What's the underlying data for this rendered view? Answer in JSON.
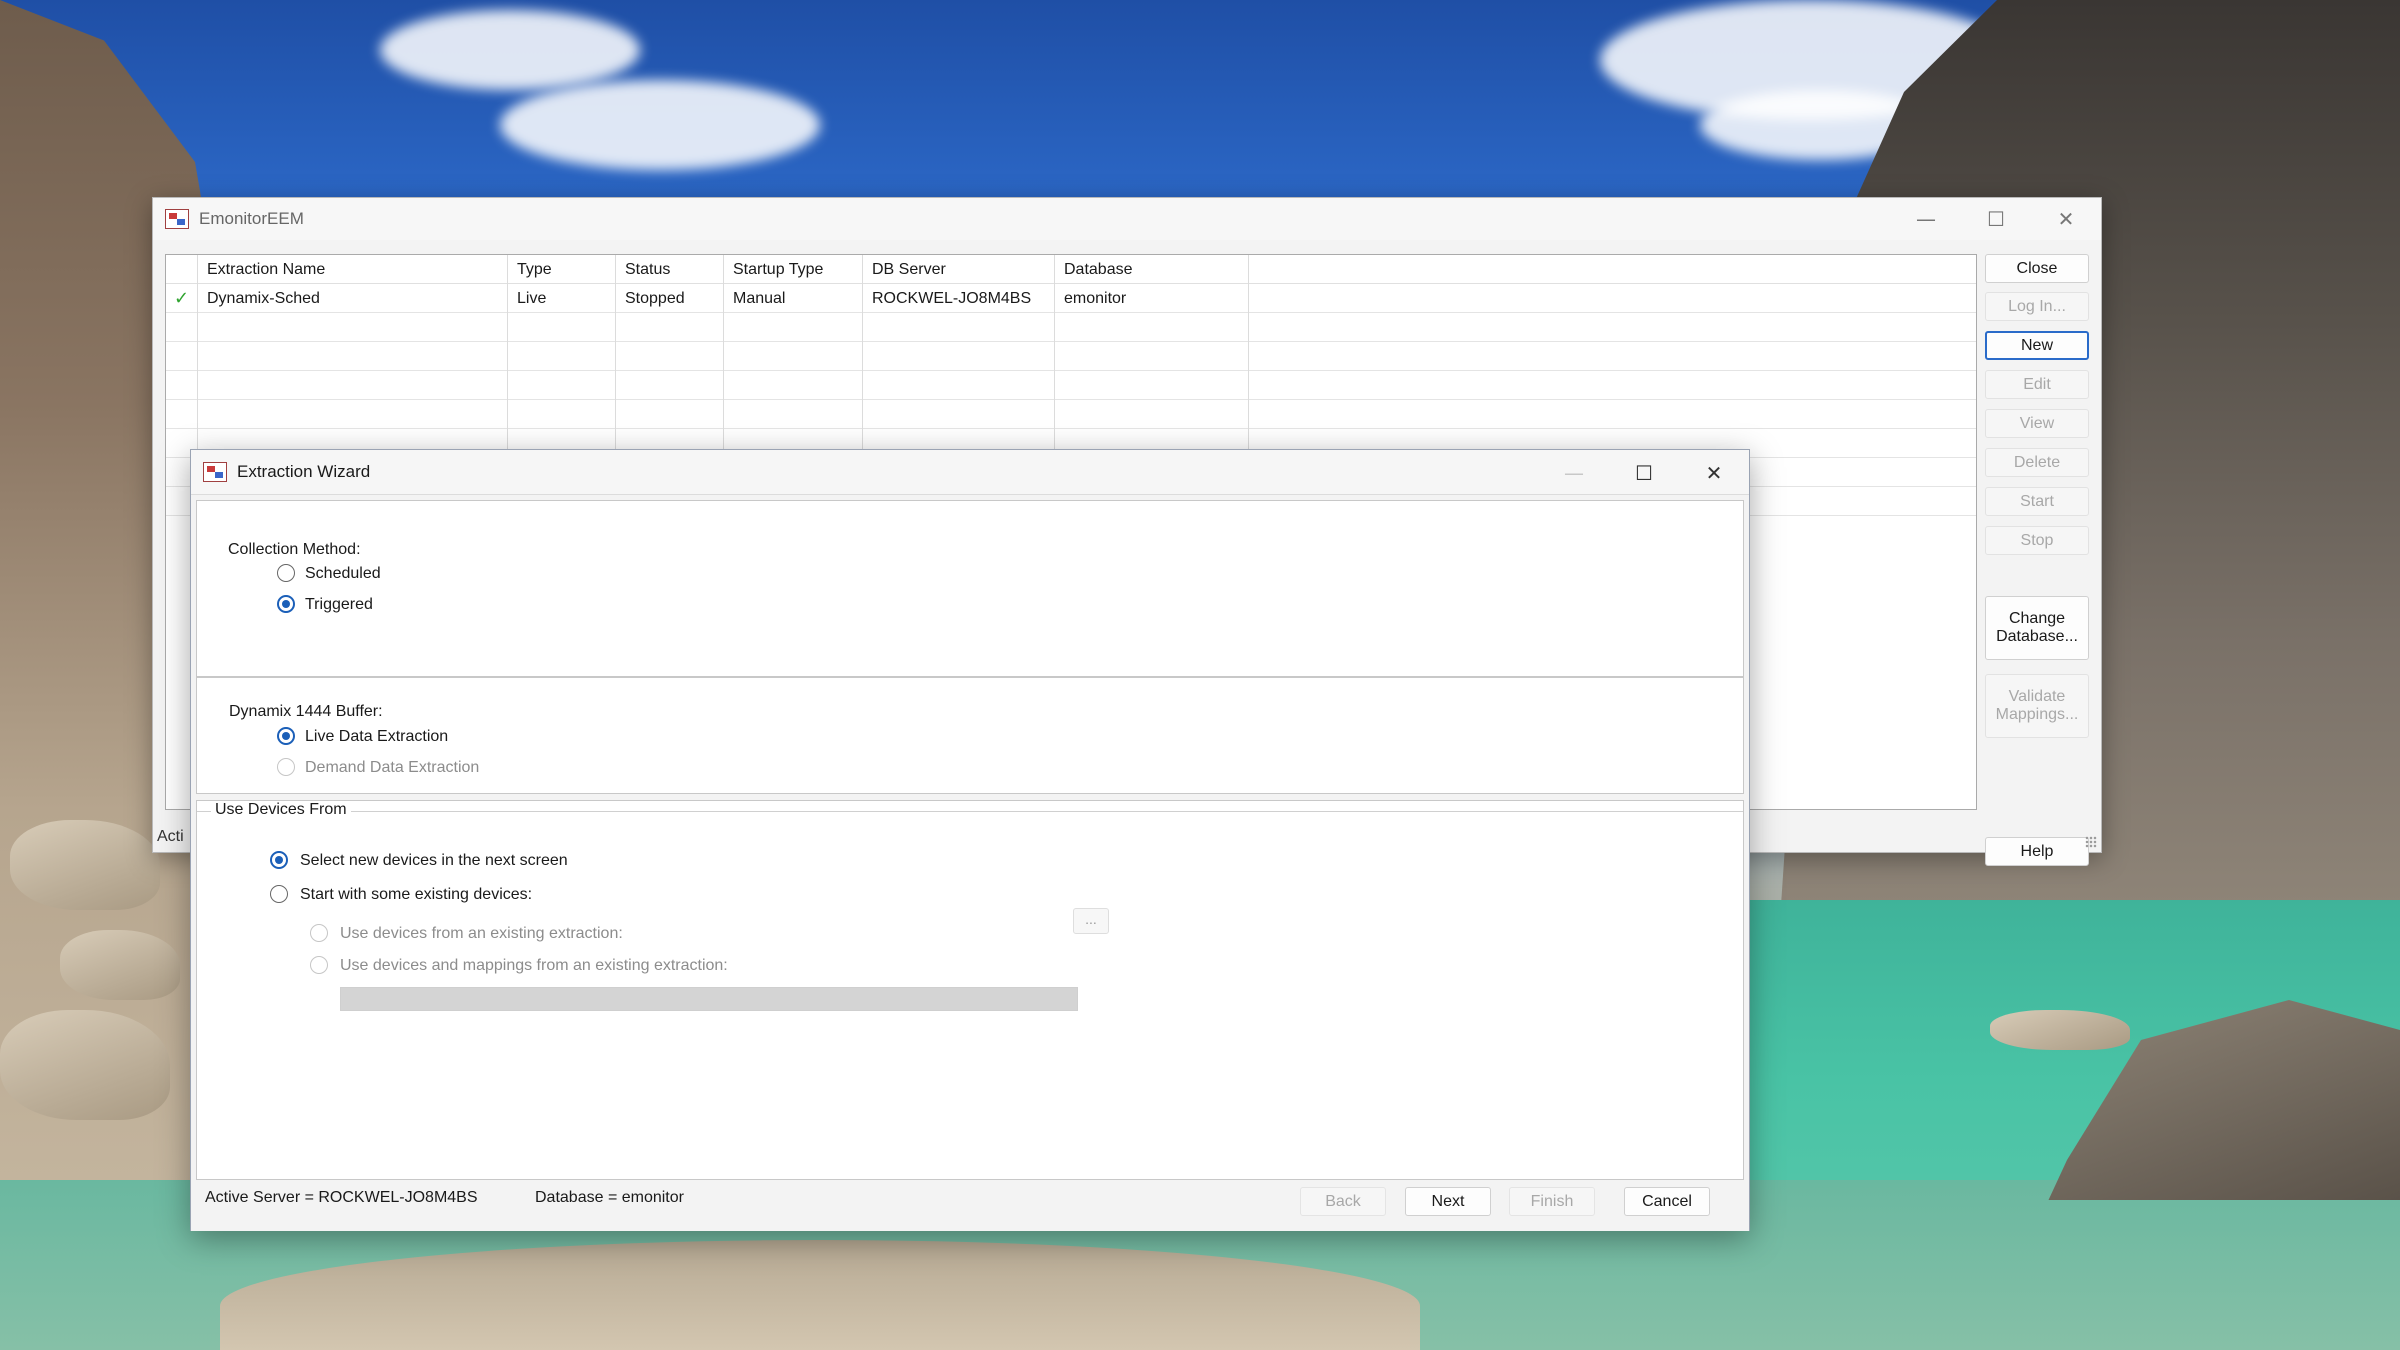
{
  "main_window": {
    "title": "EmonitorEEM",
    "controls": {
      "minimize": "—",
      "maximize": "☐",
      "close": "✕"
    },
    "columns": [
      "Extraction Name",
      "Type",
      "Status",
      "Startup Type",
      "DB Server",
      "Database"
    ],
    "rows": [
      {
        "check": "✓",
        "name": "Dynamix-Sched",
        "type": "Live",
        "status": "Stopped",
        "startup": "Manual",
        "server": "ROCKWEL-JO8M4BS",
        "database": "emonitor"
      }
    ],
    "buttons": {
      "close": "Close",
      "login": "Log In...",
      "new": "New",
      "edit": "Edit",
      "view": "View",
      "delete": "Delete",
      "start": "Start",
      "stop": "Stop",
      "change_db_1": "Change",
      "change_db_2": "Database...",
      "validate_1": "Validate",
      "validate_2": "Mappings...",
      "help": "Help"
    },
    "status_text": "Acti"
  },
  "wizard": {
    "title": "Extraction Wizard",
    "controls": {
      "minimize": "—",
      "maximize": "☐",
      "close": "✕"
    },
    "collection": {
      "label": "Collection Method:",
      "options": [
        "Scheduled",
        "Triggered"
      ],
      "selected": "Triggered"
    },
    "buffer": {
      "label": "Dynamix 1444 Buffer:",
      "options": [
        "Live Data Extraction",
        "Demand Data Extraction"
      ],
      "selected": "Live Data Extraction"
    },
    "devices": {
      "group_label": "Use Devices From",
      "options": [
        "Select new devices in the next screen",
        "Start with some existing devices:"
      ],
      "selected": "Select new devices in the next screen",
      "sub_options": [
        "Use devices from an existing extraction:",
        "Use devices and mappings from an existing extraction:"
      ],
      "browse_label": "..."
    },
    "status": {
      "server": "Active Server = ROCKWEL-JO8M4BS",
      "database": "Database = emonitor"
    },
    "buttons": {
      "back": "Back",
      "next": "Next",
      "finish": "Finish",
      "cancel": "Cancel"
    }
  }
}
